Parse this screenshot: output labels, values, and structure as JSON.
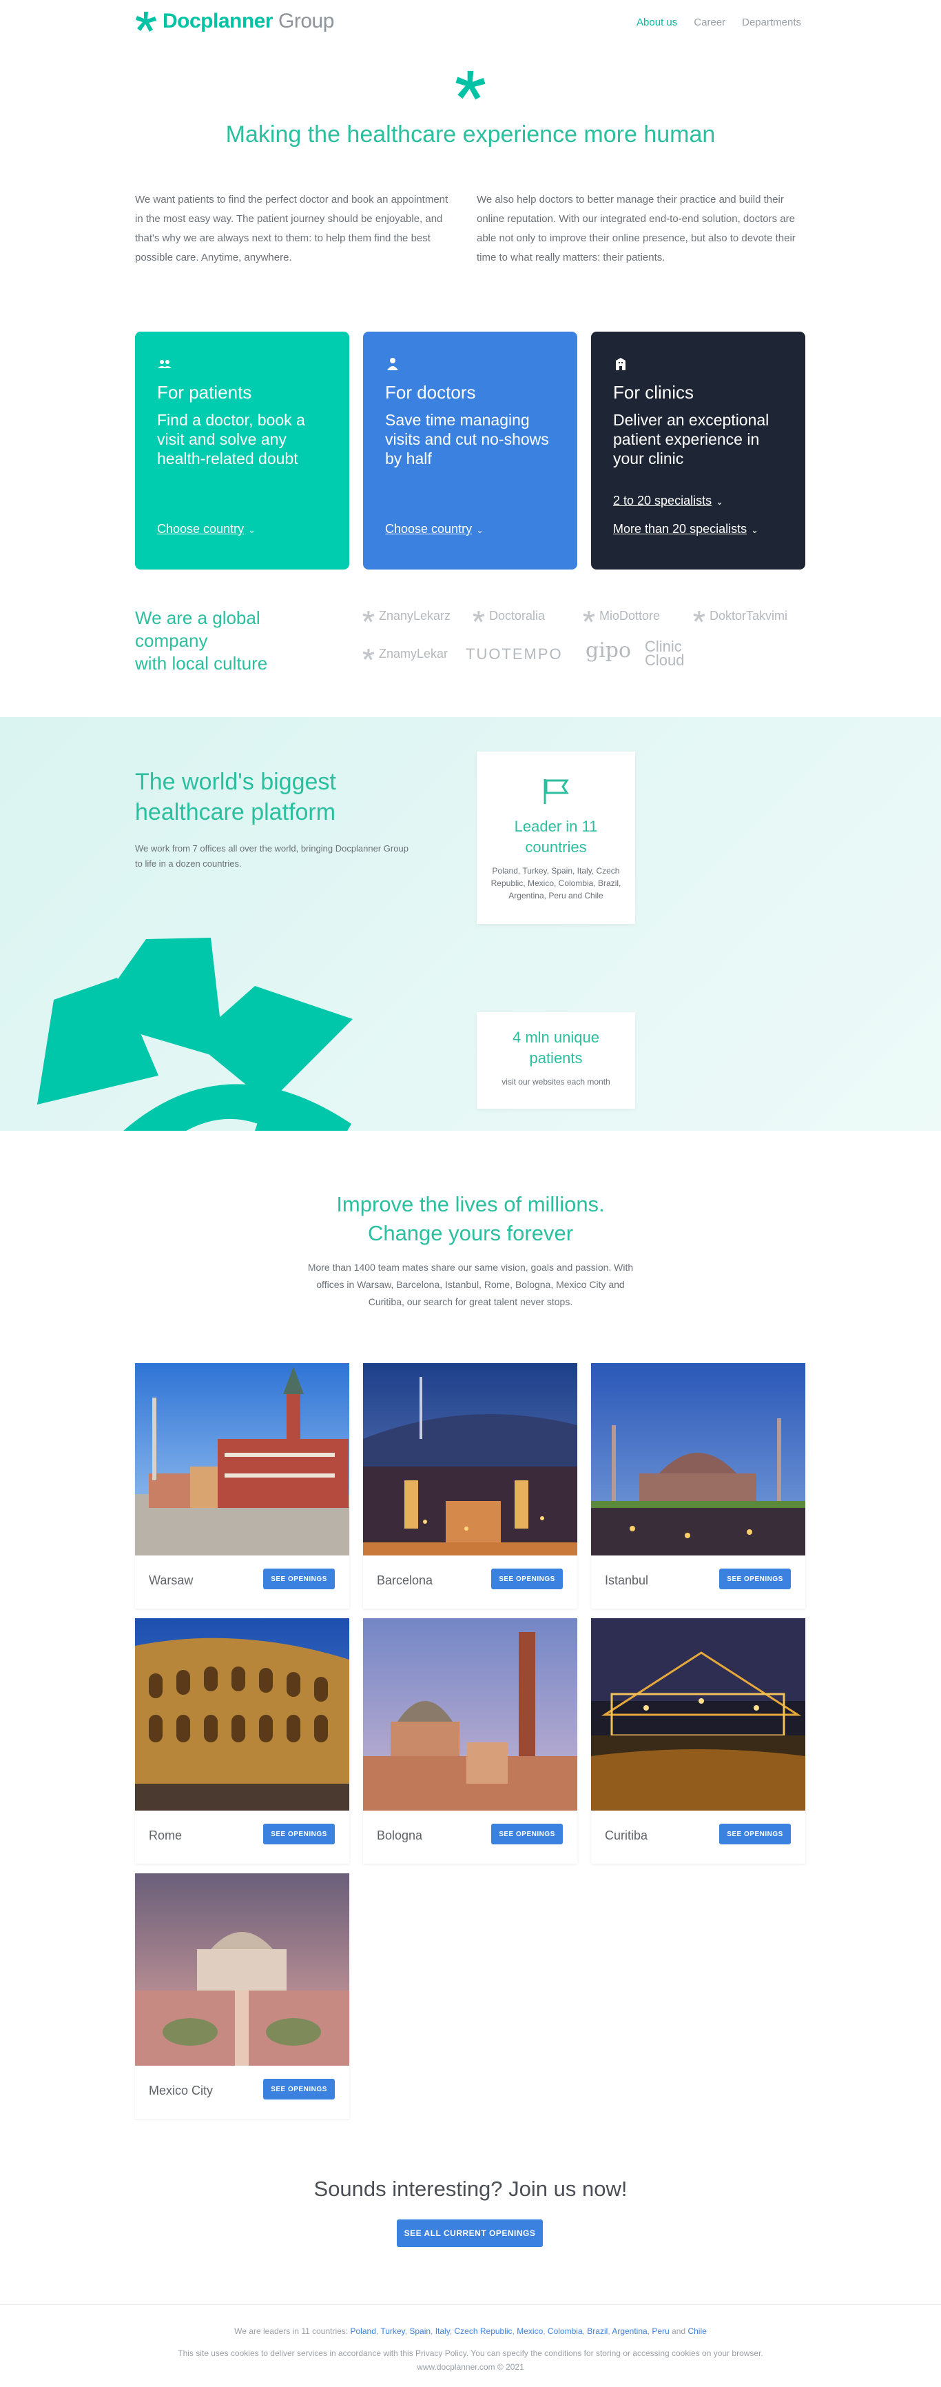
{
  "header": {
    "logo_main": "Docplanner",
    "logo_sub": "Group",
    "nav": [
      {
        "label": "About us",
        "active": true
      },
      {
        "label": "Career",
        "active": false
      },
      {
        "label": "Departments",
        "active": false
      }
    ]
  },
  "intro": {
    "title": "Making the healthcare experience more human",
    "col_left": "We want patients to find the perfect doctor and book an appointment in the most easy way. The patient journey should be enjoyable, and that's why we are always next to them: to help them find the best possible care. Anytime, anywhere.",
    "col_right": "We also help doctors to better manage their practice and build their online reputation. With our integrated end-to-end solution, doctors are able not only to improve their online presence, but also to devote their time to what really matters: their patients."
  },
  "cards": {
    "patients": {
      "title": "For patients",
      "text": "Find a doctor, book a visit and solve any health-related doubt",
      "link": "Choose country",
      "icon": "users-icon"
    },
    "doctors": {
      "title": "For doctors",
      "text": "Save time managing visits and cut no-shows by half",
      "link": "Choose country",
      "icon": "doctor-icon"
    },
    "clinics": {
      "title": "For clinics",
      "text": "Deliver an exceptional patient experience in your clinic",
      "link1": "2 to 20 specialists",
      "link2": "More than 20 specialists",
      "icon": "building-icon"
    }
  },
  "global": {
    "title_line1": "We are a global",
    "title_line2": "company",
    "title_line3": "with local culture",
    "brands": [
      "ZnanyLekarz",
      "Doctoralia",
      "MioDottore",
      "DoktorTakvimi",
      "ZnamyLekar",
      "TUOTEMPO",
      "gipo",
      "Clinic",
      "Cloud"
    ]
  },
  "world": {
    "title": "The world's biggest healthcare platform",
    "text": "We work from 7 offices all over the world, bringing Docplanner Group to life in a dozen countries.",
    "stat1_title": "Leader in 11 countries",
    "stat1_text": "Poland, Turkey, Spain, Italy, Czech Republic, Mexico, Colombia, Brazil, Argentina, Peru and Chile",
    "stat2_title": "4 mln unique patients",
    "stat2_text": "visit our websites each month"
  },
  "improve": {
    "title_line1": "Improve the lives of millions.",
    "title_line2": "Change yours forever",
    "text": "More than 1400 team mates share our same vision, goals and passion. With offices in Warsaw, Barcelona, Istanbul, Rome, Bologna, Mexico City and Curitiba, our search for great talent never stops."
  },
  "cities": [
    {
      "name": "Warsaw",
      "button": "SEE OPENINGS"
    },
    {
      "name": "Barcelona",
      "button": "SEE OPENINGS"
    },
    {
      "name": "Istanbul",
      "button": "SEE OPENINGS"
    },
    {
      "name": "Rome",
      "button": "SEE OPENINGS"
    },
    {
      "name": "Bologna",
      "button": "SEE OPENINGS"
    },
    {
      "name": "Curitiba",
      "button": "SEE OPENINGS"
    },
    {
      "name": "Mexico City",
      "button": "SEE OPENINGS"
    }
  ],
  "join": {
    "title": "Sounds interesting? Join us now!",
    "button": "SEE ALL CURRENT OPENINGS"
  },
  "footer": {
    "countries_prefix": "We are leaders in 11 countries:",
    "countries": [
      "Poland",
      "Turkey",
      "Spain",
      "Italy",
      "Czech Republic",
      "Mexico",
      "Colombia",
      "Brazil",
      "Argentina",
      "Peru"
    ],
    "countries_and": "and",
    "last_country": "Chile",
    "cookie": "This site uses cookies to deliver services in accordance with this Privacy Policy. You can specify the conditions for storing or accessing cookies on your browser.",
    "copyright": "www.docplanner.com © 2021"
  },
  "colors": {
    "brand_green": "#00c3a5",
    "title_green": "#2cbf9f",
    "patients_card": "#00cdb0",
    "doctors_card": "#3b82e0",
    "clinics_card": "#1e2535",
    "button_blue": "#3b82e0"
  }
}
